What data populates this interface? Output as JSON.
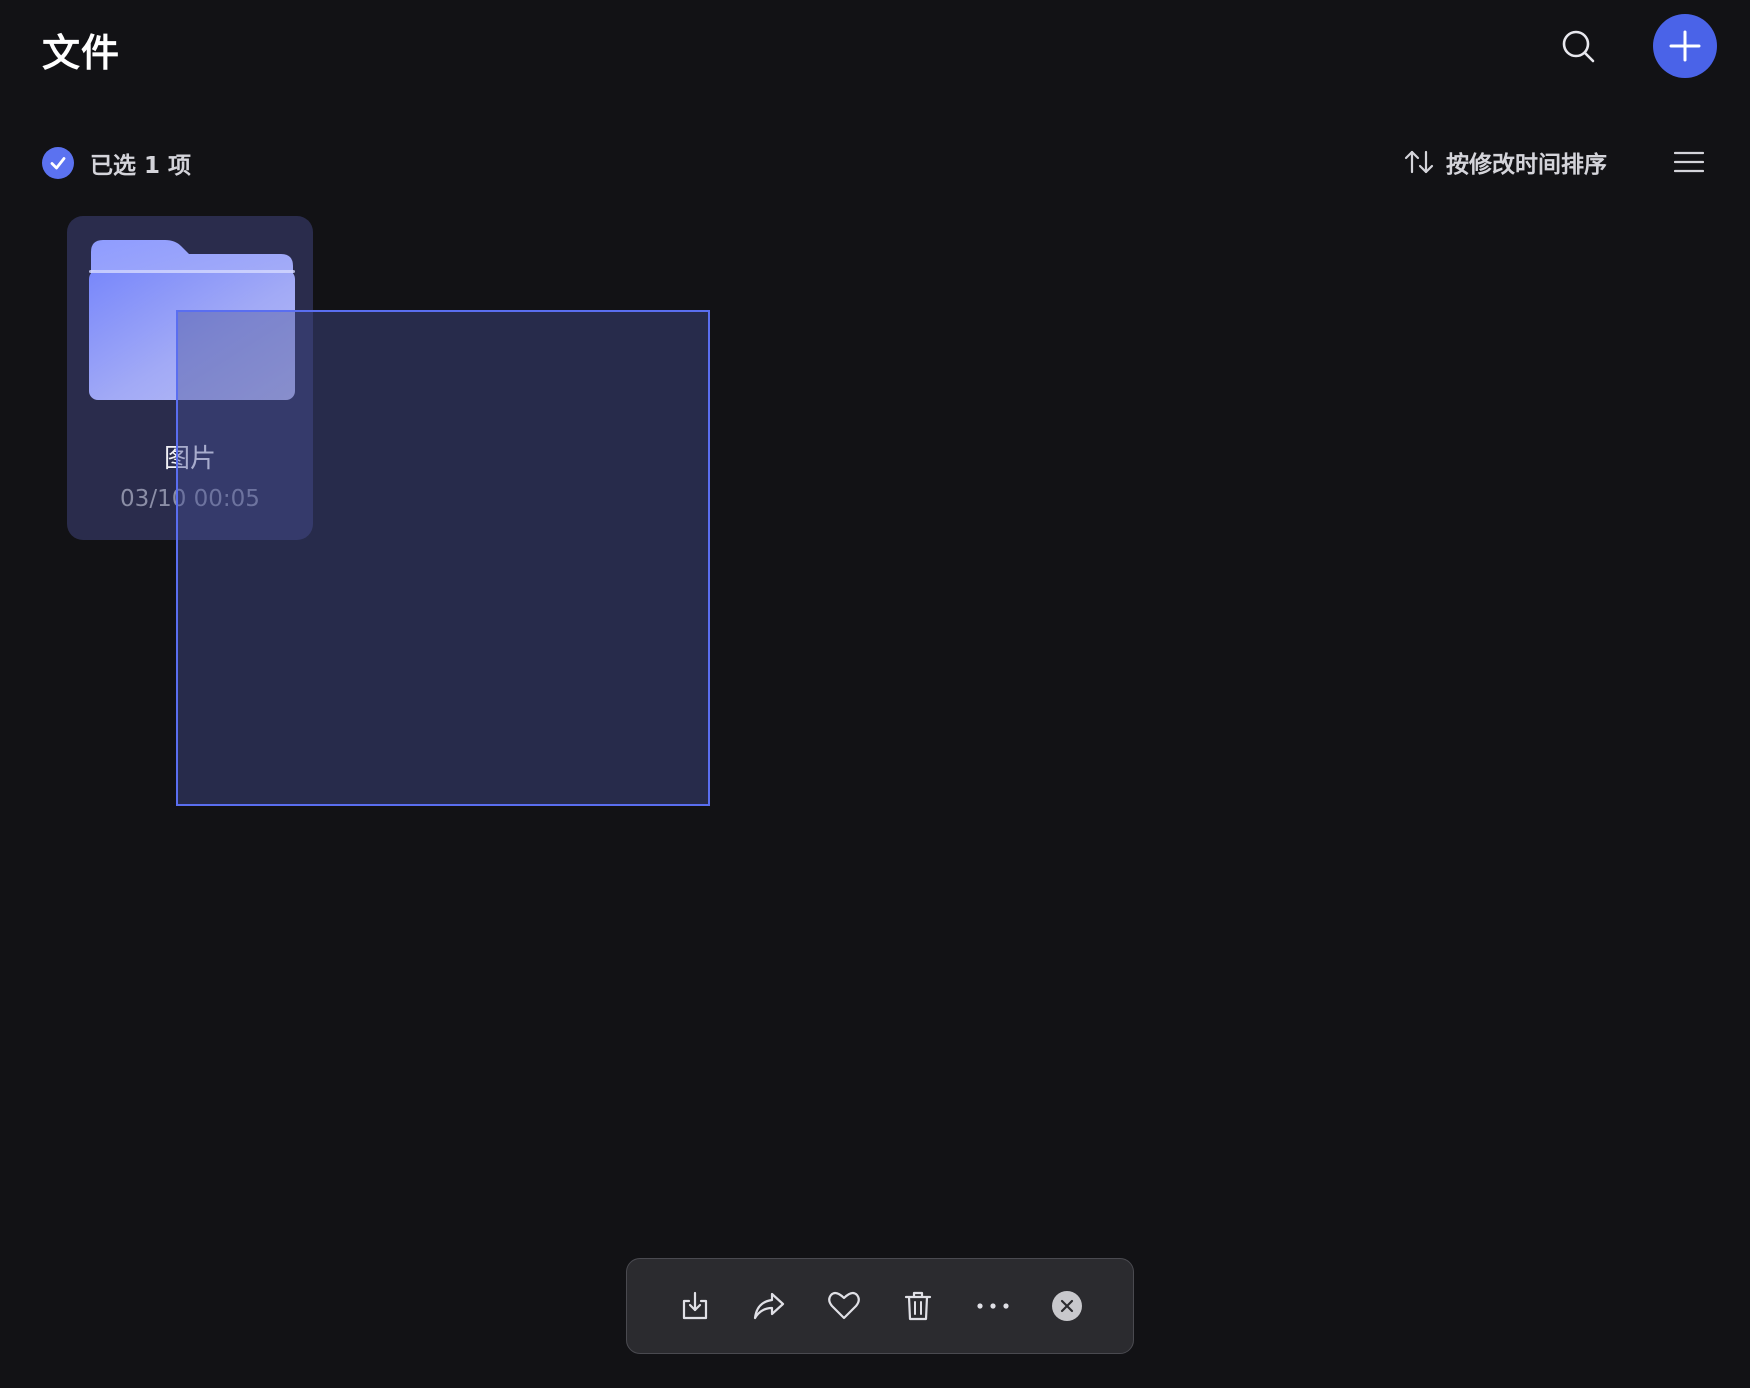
{
  "header": {
    "title": "文件",
    "search_icon": "search-icon",
    "add_icon": "plus-icon"
  },
  "selection": {
    "text": "已选 1 项"
  },
  "sort": {
    "label": "按修改时间排序",
    "icon": "sort-arrows-icon"
  },
  "view_menu_icon": "list-view-icon",
  "files": [
    {
      "name": "图片",
      "modified": "03/10 00:05",
      "type": "folder",
      "selected": true
    }
  ],
  "toolbar": {
    "actions": [
      "download-icon",
      "share-icon",
      "favorite-icon",
      "delete-icon",
      "more-icon",
      "close-icon"
    ]
  },
  "colors": {
    "background": "#121215",
    "accent": "#4a63e8",
    "selected_card": "#2a2c4c",
    "marquee_border": "#5a6ef0"
  }
}
